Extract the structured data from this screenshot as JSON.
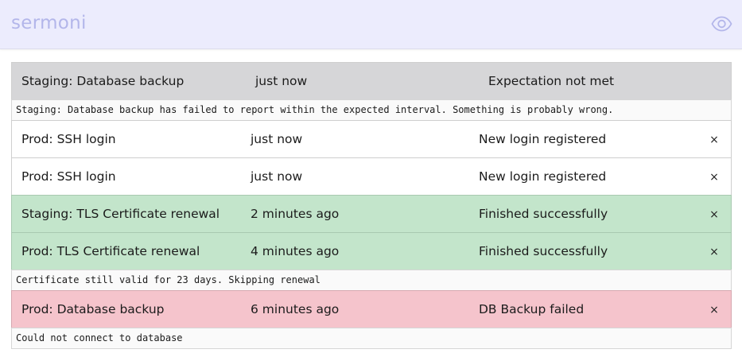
{
  "app": {
    "title": "sermoni",
    "eye_icon": "eye-icon"
  },
  "colors": {
    "header_bg": "#ececfd",
    "brand": "#b3b6ea",
    "neutral": "#ffffff",
    "grey": "#d6d6d8",
    "success": "#c3e5cb",
    "failure": "#f5c4cc"
  },
  "events": [
    {
      "service": "Staging: Database backup",
      "time": "just now",
      "status": "Expectation not met",
      "detail": "Staging: Database backup has failed to report within the expected interval. Something is probably wrong."
    },
    {
      "service": "Prod: SSH login",
      "time": "just now",
      "status": "New login registered",
      "close": "×"
    },
    {
      "service": "Prod: SSH login",
      "time": "just now",
      "status": "New login registered",
      "close": "×"
    },
    {
      "service": "Staging: TLS Certificate renewal",
      "time": "2 minutes ago",
      "status": "Finished successfully",
      "close": "×"
    },
    {
      "service": "Prod: TLS Certificate renewal",
      "time": "4 minutes ago",
      "status": "Finished successfully",
      "close": "×",
      "detail": "Certificate still valid for 23 days. Skipping renewal"
    },
    {
      "service": "Prod: Database backup",
      "time": "6 minutes ago",
      "status": "DB Backup failed",
      "close": "×",
      "detail": "Could not connect to database"
    }
  ]
}
